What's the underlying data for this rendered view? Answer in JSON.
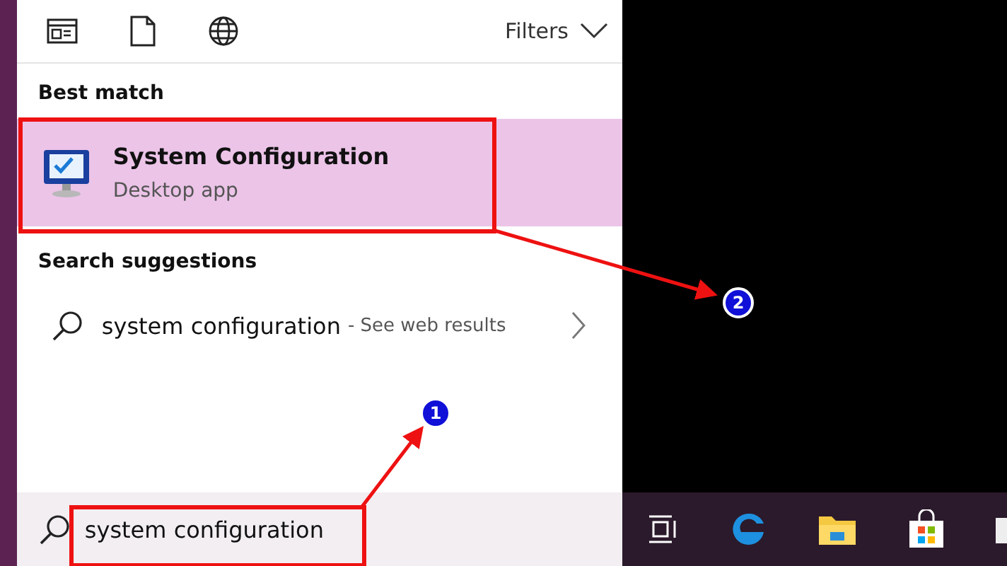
{
  "toolbar": {
    "filters_label": "Filters"
  },
  "best_match": {
    "heading": "Best match",
    "result": {
      "title": "System Configuration",
      "subtitle": "Desktop app",
      "selected": true
    }
  },
  "search_suggestions": {
    "heading": "Search suggestions",
    "items": [
      {
        "query": "system configuration",
        "hint": "- See web results"
      }
    ]
  },
  "search_box": {
    "value": "system configuration"
  },
  "annotations": [
    {
      "label": "1"
    },
    {
      "label": "2"
    }
  ]
}
